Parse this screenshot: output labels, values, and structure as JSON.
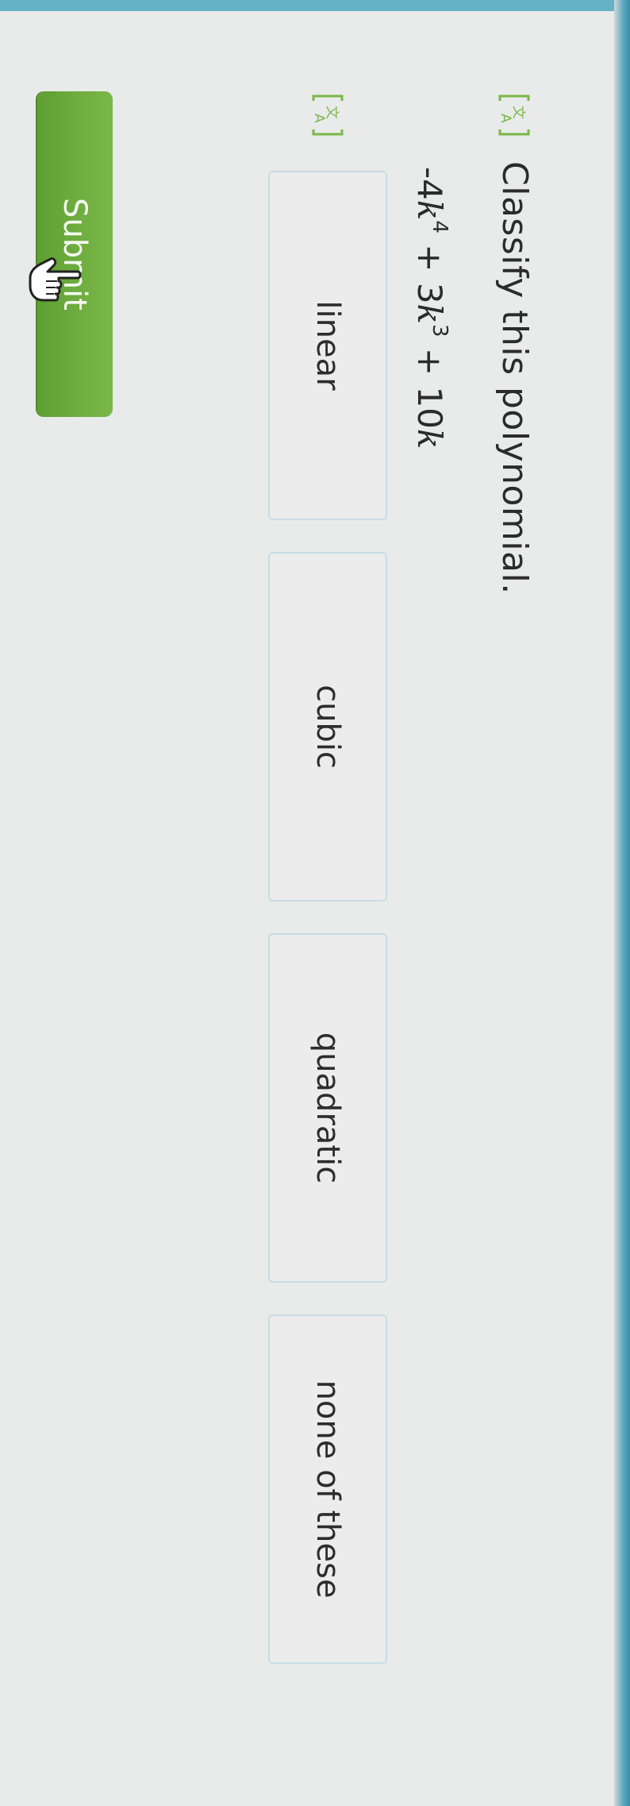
{
  "question": {
    "prompt": "Classify this polynomial.",
    "expression": {
      "term1_coef": "-4",
      "term1_var": "k",
      "term1_exp": "4",
      "op1": "+",
      "term2_coef": "3",
      "term2_var": "k",
      "term2_exp": "3",
      "op2": "+",
      "term3_coef": "10",
      "term3_var": "k"
    }
  },
  "choices": [
    {
      "label": "linear"
    },
    {
      "label": "cubic"
    },
    {
      "label": "quadratic"
    },
    {
      "label": "none of these"
    }
  ],
  "submit": {
    "label": "Submit"
  },
  "colors": {
    "accent_green": "#6aab3c",
    "choice_border": "#c6dde6",
    "tts_icon_green": "#7ab848",
    "screen_edge_teal": "#66b3c8"
  },
  "icons": {
    "tts": "text-to-speech-icon",
    "cursor": "hand-pointer-icon"
  }
}
